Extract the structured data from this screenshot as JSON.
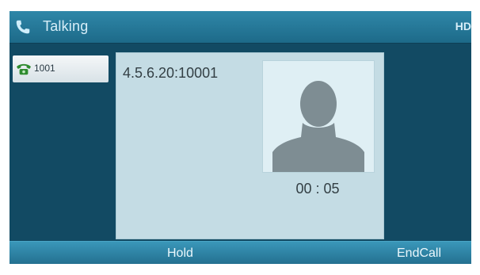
{
  "title_bar": {
    "title": "Talking",
    "right_label": "HD",
    "icon": "phone-icon"
  },
  "line": {
    "label": "1001",
    "icon": "phone-line-icon",
    "status_color": "#2e8b2e"
  },
  "call": {
    "number": "4.5.6.20:10001",
    "timer": "00 : 05",
    "avatar_icon": "person-avatar-icon"
  },
  "softkeys": {
    "hold": "Hold",
    "end_call": "EndCall"
  },
  "colors": {
    "background": "#124a63",
    "title_bar": "#1d6a89",
    "softkey_bar": "#236f8f",
    "panel": "#c4dce4"
  }
}
